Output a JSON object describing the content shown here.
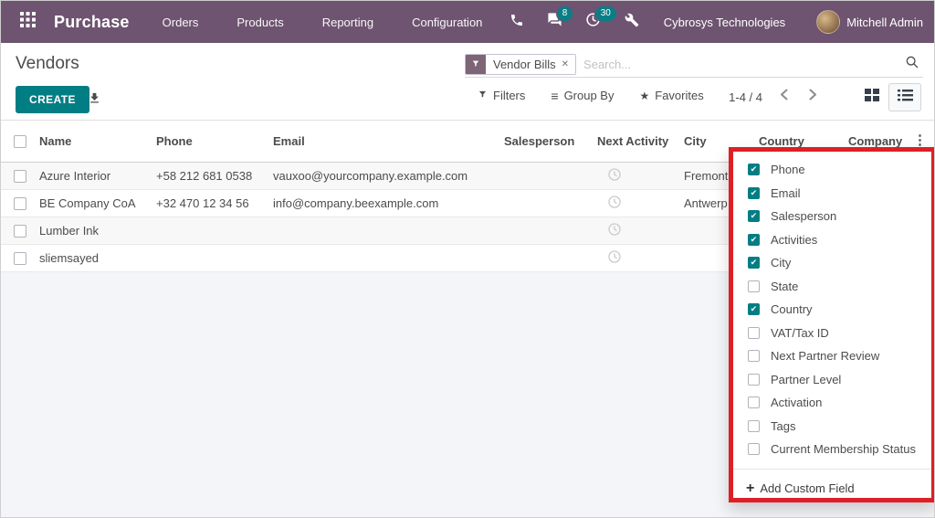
{
  "navbar": {
    "brand": "Purchase",
    "menus": [
      "Orders",
      "Products",
      "Reporting",
      "Configuration"
    ],
    "badges": {
      "messages": "8",
      "activities": "30"
    },
    "company": "Cybrosys Technologies",
    "user": "Mitchell Admin"
  },
  "breadcrumb": {
    "title": "Vendors"
  },
  "search": {
    "facet_label": "Vendor Bills",
    "placeholder": "Search..."
  },
  "toolbar": {
    "create_label": "CREATE",
    "filters_label": "Filters",
    "group_by_label": "Group By",
    "favorites_label": "Favorites",
    "pager_text": "1-4 / 4"
  },
  "icons": {
    "close": "✕",
    "ellipsis": "⋮",
    "star": "★",
    "group_by": "≡",
    "plus": "+"
  },
  "table": {
    "headers": [
      "Name",
      "Phone",
      "Email",
      "Salesperson",
      "Next Activity",
      "City",
      "Country",
      "Company"
    ],
    "rows": [
      {
        "name": "Azure Interior",
        "phone": "+58 212 681 0538",
        "email": "vauxoo@yourcompany.example.com",
        "city": "Fremont"
      },
      {
        "name": "BE Company CoA",
        "phone": "+32 470 12 34 56",
        "email": "info@company.beexample.com",
        "city": "Antwerp"
      },
      {
        "name": "Lumber Ink",
        "phone": "",
        "email": "",
        "city": ""
      },
      {
        "name": "sliemsayed",
        "phone": "",
        "email": "",
        "city": ""
      }
    ]
  },
  "dropdown": {
    "items": [
      {
        "label": "Phone",
        "checked": true
      },
      {
        "label": "Email",
        "checked": true
      },
      {
        "label": "Salesperson",
        "checked": true
      },
      {
        "label": "Activities",
        "checked": true
      },
      {
        "label": "City",
        "checked": true
      },
      {
        "label": "State",
        "checked": false
      },
      {
        "label": "Country",
        "checked": true
      },
      {
        "label": "VAT/Tax ID",
        "checked": false
      },
      {
        "label": "Next Partner Review",
        "checked": false
      },
      {
        "label": "Partner Level",
        "checked": false
      },
      {
        "label": "Activation",
        "checked": false
      },
      {
        "label": "Tags",
        "checked": false
      },
      {
        "label": "Current Membership Status",
        "checked": false
      }
    ],
    "add_custom_field_label": "Add Custom Field"
  },
  "colors": {
    "navbar": "#6e5470",
    "accent": "#017e84",
    "annotation": "#dd2025"
  }
}
